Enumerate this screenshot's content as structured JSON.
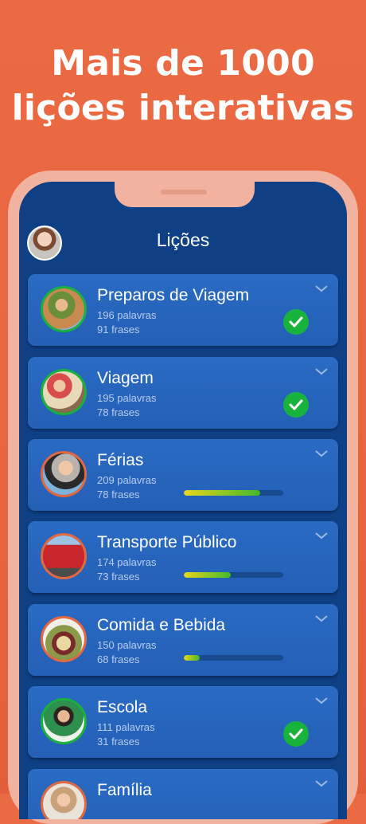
{
  "headline": {
    "line1": "Mais de 1000",
    "line2": "lições interativas"
  },
  "app": {
    "title": "Lições"
  },
  "lessons": [
    {
      "name": "Preparos de Viagem",
      "words": "196 palavras",
      "phrases": "91 frases",
      "status": "complete"
    },
    {
      "name": "Viagem",
      "words": "195 palavras",
      "phrases": "78 frases",
      "status": "complete"
    },
    {
      "name": "Férias",
      "words": "209 palavras",
      "phrases": "78 frases",
      "status": "in-progress",
      "progress": 0.77
    },
    {
      "name": "Transporte Público",
      "words": "174 palavras",
      "phrases": "73 frases",
      "status": "in-progress",
      "progress": 0.47
    },
    {
      "name": "Comida e Bebida",
      "words": "150 palavras",
      "phrases": "68 frases",
      "status": "in-progress",
      "progress": 0.16
    },
    {
      "name": "Escola",
      "words": "111 palavras",
      "phrases": "31 frases",
      "status": "complete"
    },
    {
      "name": "Família",
      "words": "",
      "phrases": "",
      "status": "in-progress"
    }
  ],
  "colors": {
    "background": "#e8653f",
    "screen": "#0f3f85",
    "card": "#2a6bc4",
    "complete": "#17b33b"
  }
}
